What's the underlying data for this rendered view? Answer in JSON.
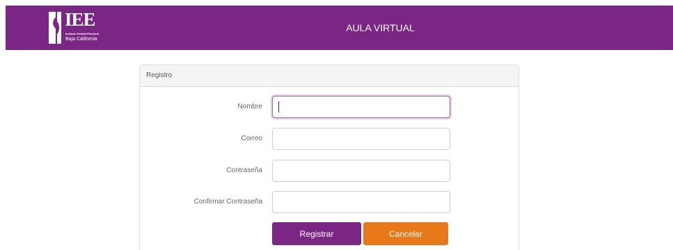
{
  "header": {
    "logo_letters": "IEE",
    "logo_line1": "Instituto Estatal Electoral",
    "logo_line2": "Baja California",
    "app_title": "AULA VIRTUAL"
  },
  "form": {
    "title": "Registro",
    "fields": [
      {
        "label": "Nombre",
        "value": ""
      },
      {
        "label": "Correo",
        "value": ""
      },
      {
        "label": "Contraseña",
        "value": ""
      },
      {
        "label": "Confirmar Contraseña",
        "value": ""
      }
    ],
    "submit_label": "Registrar",
    "cancel_label": "Cancelar"
  },
  "colors": {
    "brand": "#7b2584",
    "cancel": "#e97818"
  }
}
